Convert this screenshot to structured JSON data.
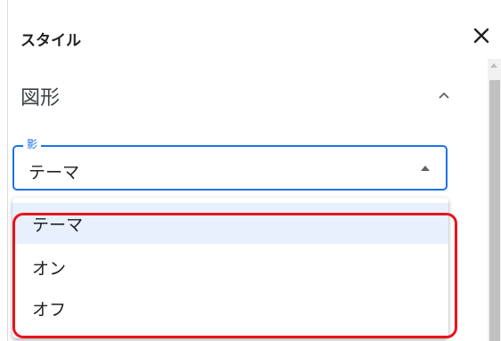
{
  "panel": {
    "title": "スタイル",
    "close_icon": "close-icon"
  },
  "section": {
    "title": "図形",
    "expanded": true,
    "toggle_icon": "chevron-up-icon"
  },
  "shadow_select": {
    "label": "影",
    "value": "テーマ",
    "arrow_icon": "dropdown-arrow-up-icon",
    "accent_color": "#1a73e8"
  },
  "menu": {
    "options": [
      {
        "label": "テーマ",
        "selected": true
      },
      {
        "label": "オン",
        "selected": false
      },
      {
        "label": "オフ",
        "selected": false
      }
    ]
  },
  "annotation": {
    "highlight_color": "#e8141b"
  }
}
